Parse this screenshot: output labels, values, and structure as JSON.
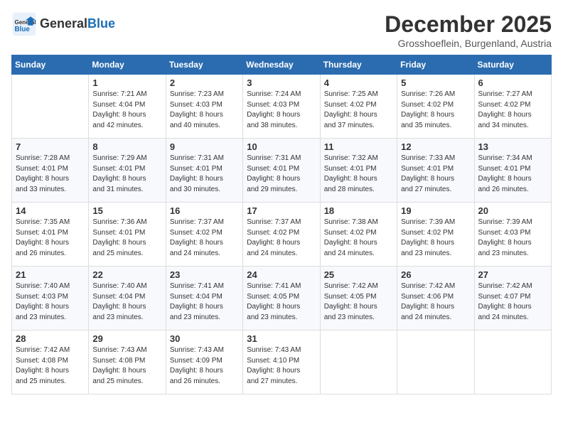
{
  "header": {
    "logo_general": "General",
    "logo_blue": "Blue",
    "month": "December 2025",
    "location": "Grosshoeflein, Burgenland, Austria"
  },
  "weekdays": [
    "Sunday",
    "Monday",
    "Tuesday",
    "Wednesday",
    "Thursday",
    "Friday",
    "Saturday"
  ],
  "weeks": [
    [
      {
        "day": "",
        "info": ""
      },
      {
        "day": "1",
        "info": "Sunrise: 7:21 AM\nSunset: 4:04 PM\nDaylight: 8 hours\nand 42 minutes."
      },
      {
        "day": "2",
        "info": "Sunrise: 7:23 AM\nSunset: 4:03 PM\nDaylight: 8 hours\nand 40 minutes."
      },
      {
        "day": "3",
        "info": "Sunrise: 7:24 AM\nSunset: 4:03 PM\nDaylight: 8 hours\nand 38 minutes."
      },
      {
        "day": "4",
        "info": "Sunrise: 7:25 AM\nSunset: 4:02 PM\nDaylight: 8 hours\nand 37 minutes."
      },
      {
        "day": "5",
        "info": "Sunrise: 7:26 AM\nSunset: 4:02 PM\nDaylight: 8 hours\nand 35 minutes."
      },
      {
        "day": "6",
        "info": "Sunrise: 7:27 AM\nSunset: 4:02 PM\nDaylight: 8 hours\nand 34 minutes."
      }
    ],
    [
      {
        "day": "7",
        "info": "Sunrise: 7:28 AM\nSunset: 4:01 PM\nDaylight: 8 hours\nand 33 minutes."
      },
      {
        "day": "8",
        "info": "Sunrise: 7:29 AM\nSunset: 4:01 PM\nDaylight: 8 hours\nand 31 minutes."
      },
      {
        "day": "9",
        "info": "Sunrise: 7:31 AM\nSunset: 4:01 PM\nDaylight: 8 hours\nand 30 minutes."
      },
      {
        "day": "10",
        "info": "Sunrise: 7:31 AM\nSunset: 4:01 PM\nDaylight: 8 hours\nand 29 minutes."
      },
      {
        "day": "11",
        "info": "Sunrise: 7:32 AM\nSunset: 4:01 PM\nDaylight: 8 hours\nand 28 minutes."
      },
      {
        "day": "12",
        "info": "Sunrise: 7:33 AM\nSunset: 4:01 PM\nDaylight: 8 hours\nand 27 minutes."
      },
      {
        "day": "13",
        "info": "Sunrise: 7:34 AM\nSunset: 4:01 PM\nDaylight: 8 hours\nand 26 minutes."
      }
    ],
    [
      {
        "day": "14",
        "info": "Sunrise: 7:35 AM\nSunset: 4:01 PM\nDaylight: 8 hours\nand 26 minutes."
      },
      {
        "day": "15",
        "info": "Sunrise: 7:36 AM\nSunset: 4:01 PM\nDaylight: 8 hours\nand 25 minutes."
      },
      {
        "day": "16",
        "info": "Sunrise: 7:37 AM\nSunset: 4:02 PM\nDaylight: 8 hours\nand 24 minutes."
      },
      {
        "day": "17",
        "info": "Sunrise: 7:37 AM\nSunset: 4:02 PM\nDaylight: 8 hours\nand 24 minutes."
      },
      {
        "day": "18",
        "info": "Sunrise: 7:38 AM\nSunset: 4:02 PM\nDaylight: 8 hours\nand 24 minutes."
      },
      {
        "day": "19",
        "info": "Sunrise: 7:39 AM\nSunset: 4:02 PM\nDaylight: 8 hours\nand 23 minutes."
      },
      {
        "day": "20",
        "info": "Sunrise: 7:39 AM\nSunset: 4:03 PM\nDaylight: 8 hours\nand 23 minutes."
      }
    ],
    [
      {
        "day": "21",
        "info": "Sunrise: 7:40 AM\nSunset: 4:03 PM\nDaylight: 8 hours\nand 23 minutes."
      },
      {
        "day": "22",
        "info": "Sunrise: 7:40 AM\nSunset: 4:04 PM\nDaylight: 8 hours\nand 23 minutes."
      },
      {
        "day": "23",
        "info": "Sunrise: 7:41 AM\nSunset: 4:04 PM\nDaylight: 8 hours\nand 23 minutes."
      },
      {
        "day": "24",
        "info": "Sunrise: 7:41 AM\nSunset: 4:05 PM\nDaylight: 8 hours\nand 23 minutes."
      },
      {
        "day": "25",
        "info": "Sunrise: 7:42 AM\nSunset: 4:05 PM\nDaylight: 8 hours\nand 23 minutes."
      },
      {
        "day": "26",
        "info": "Sunrise: 7:42 AM\nSunset: 4:06 PM\nDaylight: 8 hours\nand 24 minutes."
      },
      {
        "day": "27",
        "info": "Sunrise: 7:42 AM\nSunset: 4:07 PM\nDaylight: 8 hours\nand 24 minutes."
      }
    ],
    [
      {
        "day": "28",
        "info": "Sunrise: 7:42 AM\nSunset: 4:08 PM\nDaylight: 8 hours\nand 25 minutes."
      },
      {
        "day": "29",
        "info": "Sunrise: 7:43 AM\nSunset: 4:08 PM\nDaylight: 8 hours\nand 25 minutes."
      },
      {
        "day": "30",
        "info": "Sunrise: 7:43 AM\nSunset: 4:09 PM\nDaylight: 8 hours\nand 26 minutes."
      },
      {
        "day": "31",
        "info": "Sunrise: 7:43 AM\nSunset: 4:10 PM\nDaylight: 8 hours\nand 27 minutes."
      },
      {
        "day": "",
        "info": ""
      },
      {
        "day": "",
        "info": ""
      },
      {
        "day": "",
        "info": ""
      }
    ]
  ]
}
